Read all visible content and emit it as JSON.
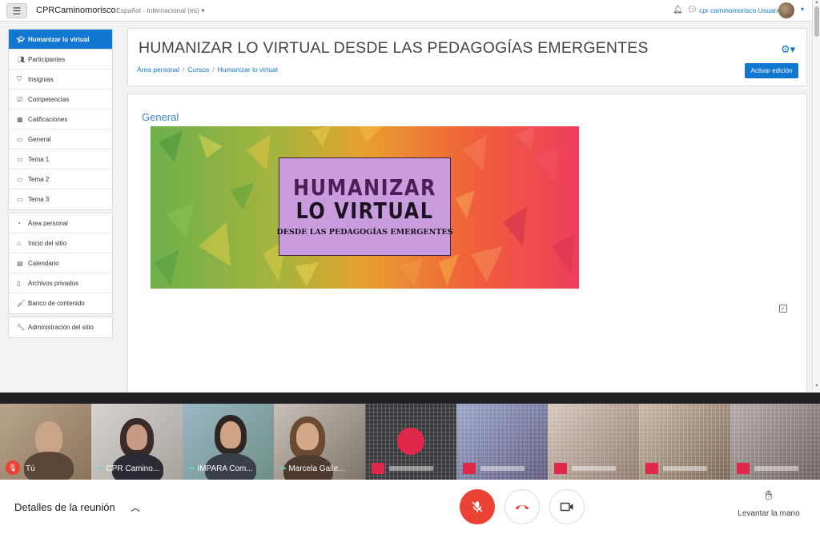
{
  "navbar": {
    "site_name": "CPRCaminomorisco",
    "language": "Español - Internacional (es) ▾",
    "user_name": "cpr caminomorisco Usuario"
  },
  "sidebar": {
    "course_group": [
      {
        "label": "Humanizar lo virtual",
        "icon": "graduation-cap-icon",
        "active": true
      },
      {
        "label": "Participantes",
        "icon": "users-icon"
      },
      {
        "label": "Insignias",
        "icon": "shield-icon"
      },
      {
        "label": "Competencias",
        "icon": "checkbox-icon"
      },
      {
        "label": "Calificaciones",
        "icon": "table-icon"
      },
      {
        "label": "General",
        "icon": "folder-icon"
      },
      {
        "label": "Tema 1",
        "icon": "folder-icon"
      },
      {
        "label": "Tema 2",
        "icon": "folder-icon"
      },
      {
        "label": "Tema 3",
        "icon": "folder-icon"
      }
    ],
    "site_group": [
      {
        "label": "Área personal",
        "icon": "dashboard-icon"
      },
      {
        "label": "Inicio del sitio",
        "icon": "home-icon"
      },
      {
        "label": "Calendario",
        "icon": "calendar-icon"
      },
      {
        "label": "Archivos privados",
        "icon": "file-icon"
      },
      {
        "label": "Banco de contenido",
        "icon": "paint-brush-icon"
      }
    ],
    "admin_group": [
      {
        "label": "Administración del sitio",
        "icon": "wrench-icon"
      }
    ]
  },
  "header": {
    "course_title": "HUMANIZAR LO VIRTUAL DESDE LAS PEDAGOGÍAS EMERGENTES",
    "breadcrumb": [
      "Área personal",
      "Cursos",
      "Humanizar lo virtual"
    ],
    "edit_button": "Activar edición"
  },
  "content": {
    "section_title": "General",
    "banner": {
      "line1": "HUMANIZAR",
      "line2": "LO VIRTUAL",
      "line3": "DESDE LAS PEDAGOGÍAS EMERGENTES"
    }
  },
  "meet": {
    "tiles": [
      {
        "name": "Tú",
        "muted": true
      },
      {
        "name": "CPR Camino...",
        "speaking": true
      },
      {
        "name": "IMPARA Com...",
        "speaking": true
      },
      {
        "name": "Marcela Galle...",
        "speaking": true
      },
      {
        "name": ""
      },
      {
        "name": ""
      },
      {
        "name": ""
      },
      {
        "name": ""
      },
      {
        "name": ""
      }
    ],
    "meeting_details": "Detalles de la reunión",
    "raise_hand": "Levantar la mano"
  },
  "colors": {
    "moodle_primary": "#1177d1",
    "meet_red": "#ea4335",
    "meet_dark": "#202124"
  }
}
